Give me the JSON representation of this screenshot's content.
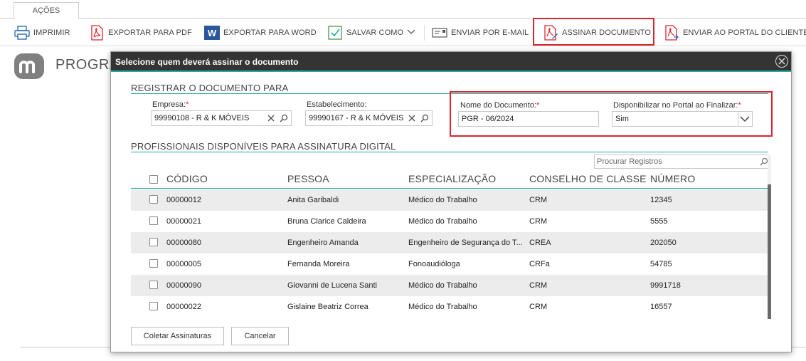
{
  "ribbon": {
    "tab": "AÇÕES",
    "buttons": {
      "print": "IMPRIMIR",
      "pdf": "EXPORTAR PARA PDF",
      "word": "EXPORTAR PARA WORD",
      "save_as": "SALVAR COMO",
      "email": "ENVIAR POR E-MAIL",
      "sign": "ASSINAR DOCUMENTO",
      "portal": "ENVIAR AO PORTAL DO CLIENTE"
    }
  },
  "page": {
    "title": "PROGRA"
  },
  "modal": {
    "title": "Selecione quem deverá assinar o documento",
    "section_register": "REGISTRAR O DOCUMENTO PARA",
    "empresa": {
      "label": "Empresa:",
      "required": "*",
      "value": "99990108 - R & K MÓVEIS"
    },
    "estabelecimento": {
      "label": "Estabelecimento:",
      "value": "99990167 - R & K MÓVEIS"
    },
    "nome_documento": {
      "label": "Nome do Documento:",
      "required": "*",
      "value": "PGR - 06/2024"
    },
    "disponibilizar": {
      "label": "Disponibilizar no Portal ao Finalizar:",
      "required": "*",
      "value": "Sim"
    },
    "section_professionals": "PROFISSIONAIS DISPONÍVEIS PARA ASSINATURA DIGITAL",
    "search_placeholder": "Procurar Registros",
    "table": {
      "headers": [
        "CÓDIGO",
        "PESSOA",
        "ESPECIALIZAÇÃO",
        "CONSELHO DE CLASSE",
        "NÚMERO"
      ],
      "rows": [
        [
          "00000012",
          "Anita Garibaldi",
          "Médico do Trabalho",
          "CRM",
          "12345"
        ],
        [
          "00000021",
          "Bruna Clarice Caldeira",
          "Médico do Trabalho",
          "CRM",
          "5555"
        ],
        [
          "00000080",
          "Engenheiro Amanda",
          "Engenheiro de Segurança do T...",
          "CREA",
          "202050"
        ],
        [
          "00000005",
          "Fernanda Moreira",
          "Fonoaudióloga",
          "CRFa",
          "54785"
        ],
        [
          "00000090",
          "Giovanni de Lucena Santi",
          "Médico do Trabalho",
          "CRM",
          "9991718"
        ],
        [
          "00000022",
          "Gislaine Beatriz Correa",
          "Médico do Trabalho",
          "CRM",
          "16557"
        ]
      ]
    },
    "buttons": {
      "collect": "Coletar Assinaturas",
      "cancel": "Cancelar"
    }
  },
  "colors": {
    "accent": "#27a9a0",
    "highlight": "#d9262e",
    "header": "#343434"
  }
}
